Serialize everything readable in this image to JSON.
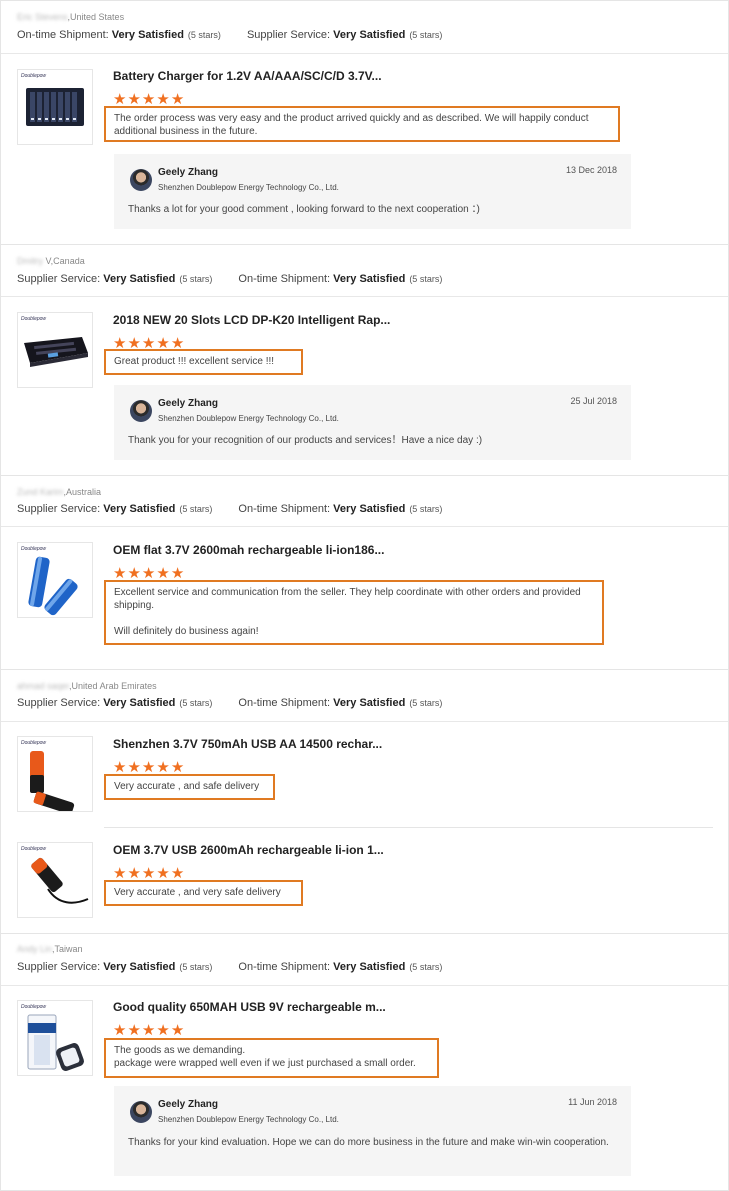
{
  "labels": {
    "ontime": "On-time Shipment:",
    "supplier": "Supplier Service:",
    "very_satisfied": "Very Satisfied",
    "five_stars": "(5 stars)"
  },
  "accent_color": "#e07a22",
  "star_color": "#f07021",
  "reviews": [
    {
      "buyer_name": "Eric Stevens",
      "buyer_country": ",United States",
      "first_rating": "On-time Shipment:",
      "second_rating": "Supplier Service:",
      "items": [
        {
          "title": "Battery Charger for 1.2V AA/AAA/SC/C/D 3.7V...",
          "rating": 5,
          "text": "The order process was very easy and the product arrived quickly and as described.  We will happily conduct additional business in the future.",
          "reply": {
            "name": "Geely Zhang",
            "company": "Shenzhen Doublepow Energy Technology Co., Ltd.",
            "date": "13 Dec 2018",
            "text": "Thanks a lot for your good comment , looking forward to the next cooperation ：)"
          }
        }
      ]
    },
    {
      "buyer_name": "Dmitry",
      "buyer_country": " V,Canada",
      "first_rating": "Supplier Service:",
      "second_rating": "On-time Shipment:",
      "items": [
        {
          "title": "2018 NEW 20 Slots LCD DP-K20 Intelligent Rap...",
          "rating": 5,
          "text": "Great product !!! excellent service !!!",
          "reply": {
            "name": "Geely Zhang",
            "company": "Shenzhen Doublepow Energy Technology Co., Ltd.",
            "date": "25 Jul 2018",
            "text": "Thank you for your recognition of our products and services！Have a nice day :)"
          }
        }
      ]
    },
    {
      "buyer_name": "Zund Karim",
      "buyer_country": ",Australia",
      "first_rating": "Supplier Service:",
      "second_rating": "On-time Shipment:",
      "items": [
        {
          "title": "OEM flat 3.7V 2600mah rechargeable li-ion186...",
          "rating": 5,
          "text_lines": [
            "Excellent service and communication from the seller. They help coordinate with other orders and provided shipping.",
            "",
            "Will definitely do business again!"
          ]
        }
      ]
    },
    {
      "buyer_name": "ahmad saqer",
      "buyer_country": ",United Arab Emirates",
      "first_rating": "Supplier Service:",
      "second_rating": "On-time Shipment:",
      "items": [
        {
          "title": "Shenzhen 3.7V 750mAh USB AA 14500 rechar...",
          "rating": 5,
          "text": "Very accurate , and safe delivery"
        },
        {
          "title": "OEM 3.7V USB 2600mAh rechargeable li-ion 1...",
          "rating": 5,
          "text": "Very accurate , and very safe delivery"
        }
      ]
    },
    {
      "buyer_name": "Andy Lin",
      "buyer_country": ",Taiwan",
      "first_rating": "Supplier Service:",
      "second_rating": "On-time Shipment:",
      "items": [
        {
          "title": "Good quality 650MAH USB 9V rechargeable m...",
          "rating": 5,
          "text_lines": [
            "The goods as we demanding.",
            "package were wrapped well even if we just purchased a small order."
          ],
          "reply": {
            "name": "Geely Zhang",
            "company": "Shenzhen Doublepow Energy Technology Co., Ltd.",
            "date": "11 Jun 2018",
            "text": "Thanks for your kind evaluation. Hope we can do more business in the future and make win-win cooperation."
          }
        }
      ]
    }
  ],
  "thumb_brand": "Doublepow"
}
